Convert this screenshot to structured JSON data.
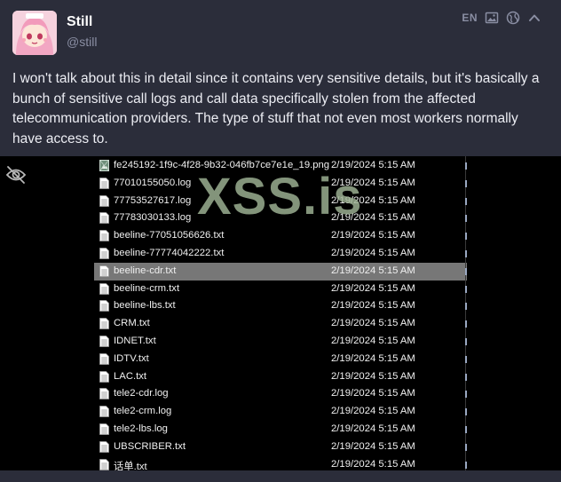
{
  "post": {
    "display_name": "Still",
    "handle": "@still",
    "language": "EN",
    "text": "I won't talk about this in detail since it contains very sensitive details, but it's basically a bunch of sensitive call logs and call data specifically stolen from the affected telecommunication providers. The type of stuff that not even most workers normally have access to.",
    "icons": [
      "image-icon",
      "globe-icon",
      "chevron-up-icon"
    ]
  },
  "media": {
    "hide_icon": "eye-slash-icon",
    "watermark": "XSS.is",
    "files": [
      {
        "name": "fe245192-1f9c-4f28-9b32-046fb7ce7e1e_19.png",
        "date": "2/19/2024 5:15 AM",
        "icon": "image-file-icon"
      },
      {
        "name": "77010155050.log",
        "date": "2/19/2024 5:15 AM",
        "icon": "document-icon"
      },
      {
        "name": "77753527617.log",
        "date": "2/19/2024 5:15 AM",
        "icon": "document-icon"
      },
      {
        "name": "77783030133.log",
        "date": "2/19/2024 5:15 AM",
        "icon": "document-icon"
      },
      {
        "name": "beeline-77051056626.txt",
        "date": "2/19/2024 5:15 AM",
        "icon": "document-icon"
      },
      {
        "name": "beeline-77774042222.txt",
        "date": "2/19/2024 5:15 AM",
        "icon": "document-icon"
      },
      {
        "name": "beeline-cdr.txt",
        "date": "2/19/2024 5:15 AM",
        "icon": "document-icon",
        "selected": true
      },
      {
        "name": "beeline-crm.txt",
        "date": "2/19/2024 5:15 AM",
        "icon": "document-icon"
      },
      {
        "name": "beeline-lbs.txt",
        "date": "2/19/2024 5:15 AM",
        "icon": "document-icon"
      },
      {
        "name": "CRM.txt",
        "date": "2/19/2024 5:15 AM",
        "icon": "document-icon"
      },
      {
        "name": "IDNET.txt",
        "date": "2/19/2024 5:15 AM",
        "icon": "document-icon"
      },
      {
        "name": "IDTV.txt",
        "date": "2/19/2024 5:15 AM",
        "icon": "document-icon"
      },
      {
        "name": "LAC.txt",
        "date": "2/19/2024 5:15 AM",
        "icon": "document-icon"
      },
      {
        "name": "tele2-cdr.log",
        "date": "2/19/2024 5:15 AM",
        "icon": "document-icon"
      },
      {
        "name": "tele2-crm.log",
        "date": "2/19/2024 5:15 AM",
        "icon": "document-icon"
      },
      {
        "name": "tele2-lbs.log",
        "date": "2/19/2024 5:15 AM",
        "icon": "document-icon"
      },
      {
        "name": "UBSCRIBER.txt",
        "date": "2/19/2024 5:15 AM",
        "icon": "document-icon"
      },
      {
        "name": "话单.txt",
        "date": "2/19/2024 5:15 AM",
        "icon": "document-icon"
      }
    ]
  },
  "colors": {
    "background": "#2b2d3a",
    "text": "#ecedf3",
    "muted": "#8a8ea3",
    "media_bg": "#000000",
    "selected_row": "#777777",
    "watermark": "#a0b496"
  }
}
